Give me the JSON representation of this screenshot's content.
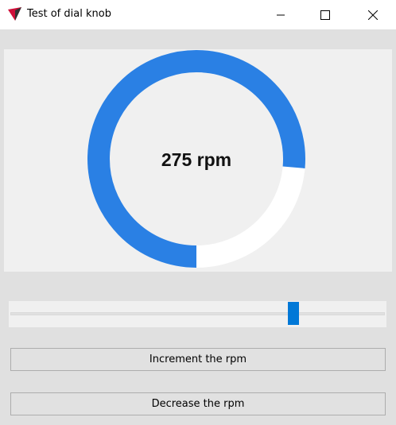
{
  "window": {
    "title": "Test of dial knob",
    "controls": [
      "minimize-icon",
      "maximize-icon",
      "close-icon"
    ]
  },
  "dial": {
    "value": 275,
    "max": 360,
    "label": "275 rpm",
    "fill_color": "#2a80e4",
    "track_color": "#ffffff"
  },
  "slider": {
    "value": 275,
    "min": 0,
    "max": 360,
    "color": "#0078d7"
  },
  "buttons": {
    "increment": "Increment the rpm",
    "decrease": "Decrease the rpm"
  }
}
